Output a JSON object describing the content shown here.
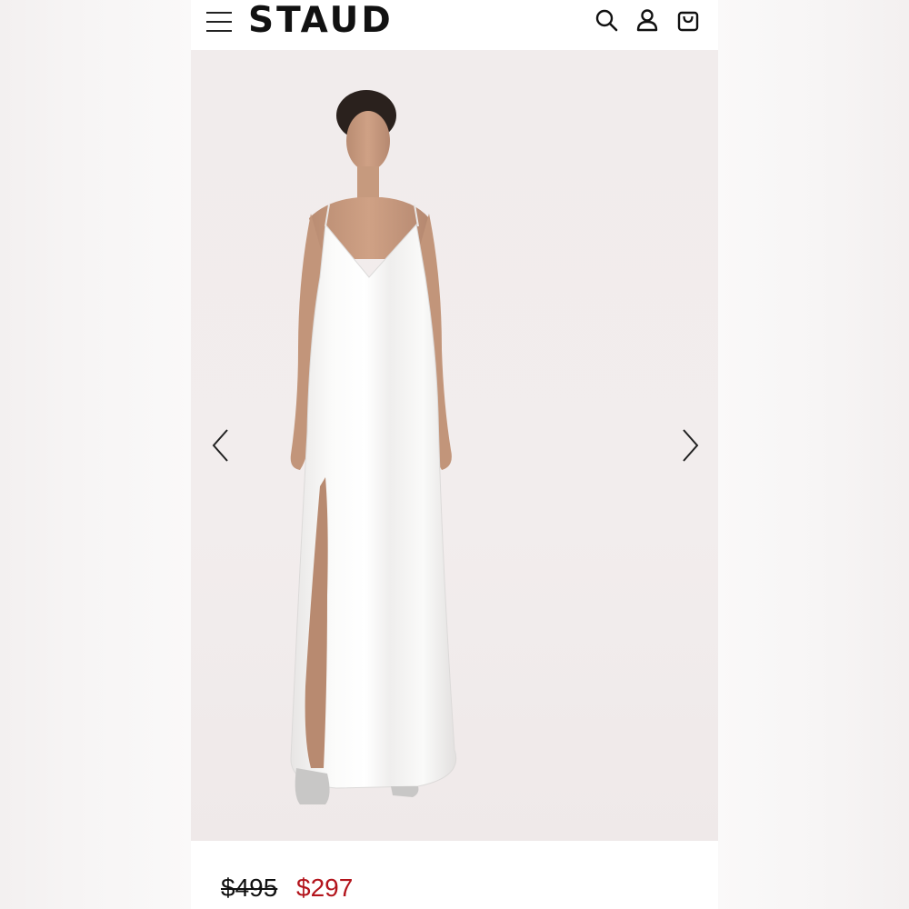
{
  "header": {
    "logo_text": "STAUD",
    "icons": [
      "menu-icon",
      "search-icon",
      "account-icon",
      "bag-icon"
    ]
  },
  "gallery": {
    "image_alt": "",
    "prev_icon": "chevron-left-icon",
    "next_icon": "chevron-right-icon"
  },
  "pricing": {
    "original_price": "$495",
    "sale_price": "$297",
    "sale_color": "#b3141c"
  },
  "colors": {
    "page_background": "#f7f5f5",
    "photo_background": "#f1ecec",
    "text": "#111111"
  }
}
